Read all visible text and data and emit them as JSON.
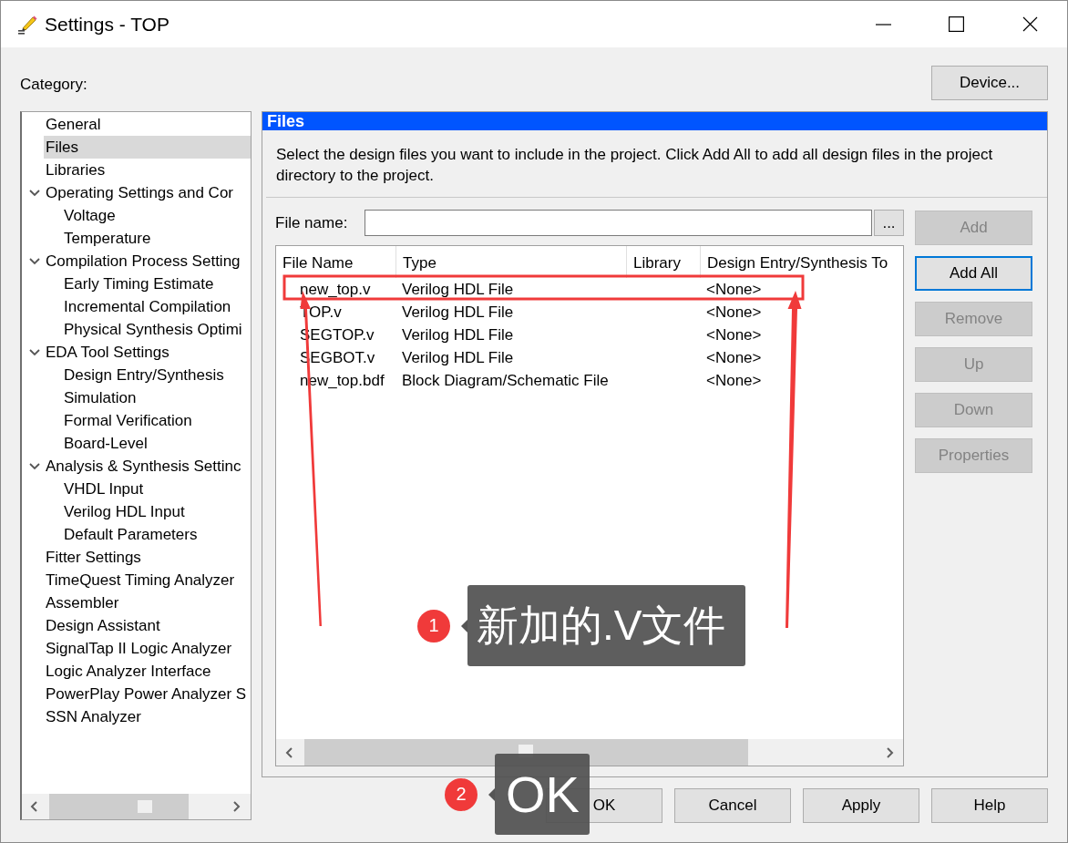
{
  "window": {
    "title": "Settings - TOP"
  },
  "category_label": "Category:",
  "device_button": "Device...",
  "category_tree": [
    {
      "label": "General",
      "selected": false
    },
    {
      "label": "Files",
      "selected": true
    },
    {
      "label": "Libraries",
      "selected": false
    },
    {
      "label": "Operating Settings and Cor",
      "selected": false,
      "expanded": true,
      "children": [
        {
          "label": "Voltage",
          "selected": false
        },
        {
          "label": "Temperature",
          "selected": false
        }
      ]
    },
    {
      "label": "Compilation Process Setting",
      "selected": false,
      "expanded": true,
      "children": [
        {
          "label": "Early Timing Estimate",
          "selected": false
        },
        {
          "label": "Incremental Compilation",
          "selected": false
        },
        {
          "label": "Physical Synthesis Optimi",
          "selected": false
        }
      ]
    },
    {
      "label": "EDA Tool Settings",
      "selected": false,
      "expanded": true,
      "children": [
        {
          "label": "Design Entry/Synthesis",
          "selected": false
        },
        {
          "label": "Simulation",
          "selected": false
        },
        {
          "label": "Formal Verification",
          "selected": false
        },
        {
          "label": "Board-Level",
          "selected": false
        }
      ]
    },
    {
      "label": "Analysis & Synthesis Settinc",
      "selected": false,
      "expanded": true,
      "children": [
        {
          "label": "VHDL Input",
          "selected": false
        },
        {
          "label": "Verilog HDL Input",
          "selected": false
        },
        {
          "label": "Default Parameters",
          "selected": false
        }
      ]
    },
    {
      "label": "Fitter Settings",
      "selected": false
    },
    {
      "label": "TimeQuest Timing Analyzer",
      "selected": false
    },
    {
      "label": "Assembler",
      "selected": false
    },
    {
      "label": "Design Assistant",
      "selected": false
    },
    {
      "label": "SignalTap II Logic Analyzer",
      "selected": false
    },
    {
      "label": "Logic Analyzer Interface",
      "selected": false
    },
    {
      "label": "PowerPlay Power Analyzer S",
      "selected": false
    },
    {
      "label": "SSN Analyzer",
      "selected": false
    }
  ],
  "panel": {
    "title": "Files",
    "description": "Select the design files you want to include in the project. Click Add All to add all design files in the project directory to the project.",
    "file_name_label": "File name:",
    "browse_button": "...",
    "table": {
      "columns": [
        "File Name",
        "Type",
        "Library",
        "Design Entry/Synthesis To"
      ],
      "rows": [
        {
          "file_name": "new_top.v",
          "type": "Verilog HDL File",
          "design_entry": "<None>",
          "selected": false,
          "highlighted": true
        },
        {
          "file_name": "TOP.v",
          "type": "Verilog HDL File",
          "design_entry": "<None>",
          "selected": false,
          "highlighted": false
        },
        {
          "file_name": "SEGTOP.v",
          "type": "Verilog HDL File",
          "design_entry": "<None>",
          "selected": false,
          "highlighted": false
        },
        {
          "file_name": "SEGBOT.v",
          "type": "Verilog HDL File",
          "design_entry": "<None>",
          "selected": false,
          "highlighted": false
        },
        {
          "file_name": "new_top.bdf",
          "type": "Block Diagram/Schematic File",
          "design_entry": "<None>",
          "selected": false,
          "highlighted": false
        }
      ]
    },
    "side_buttons": [
      {
        "label": "Add",
        "disabled": true,
        "focused": false
      },
      {
        "label": "Add All",
        "disabled": false,
        "focused": true
      },
      {
        "label": "Remove",
        "disabled": true,
        "focused": false
      },
      {
        "label": "Up",
        "disabled": true,
        "focused": false
      },
      {
        "label": "Down",
        "disabled": true,
        "focused": false
      },
      {
        "label": "Properties",
        "disabled": true,
        "focused": false
      }
    ]
  },
  "footer_buttons": [
    "OK",
    "Cancel",
    "Apply",
    "Help"
  ],
  "callouts": [
    {
      "number": "1",
      "text": "新加的.V文件"
    },
    {
      "number": "2",
      "text": "OK"
    }
  ]
}
